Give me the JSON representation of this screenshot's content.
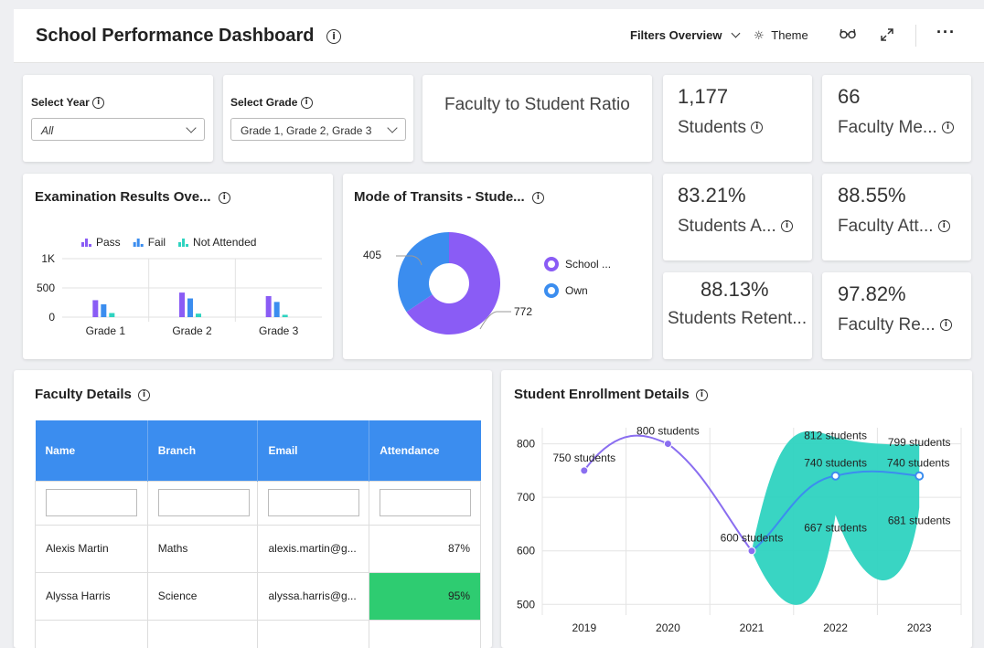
{
  "header": {
    "title": "School Performance Dashboard",
    "filters_label": "Filters Overview",
    "theme_label": "Theme"
  },
  "filters": {
    "year_label": "Select Year",
    "year_value": "All",
    "grade_label": "Select Grade",
    "grade_value": "Grade 1, Grade 2, Grade 3"
  },
  "kpis": {
    "ratio_title": "Faculty to Student Ratio",
    "students_value": "1,177",
    "students_label": "Students",
    "faculty_value": "66",
    "faculty_label": "Faculty Me...",
    "stud_att_value": "83.21%",
    "stud_att_label": "Students A...",
    "fac_att_value": "88.55%",
    "fac_att_label": "Faculty Att...",
    "stud_ret_value": "88.13%",
    "stud_ret_label": "Students Retent...",
    "fac_ret_value": "97.82%",
    "fac_ret_label": "Faculty Re..."
  },
  "exam": {
    "title": "Examination Results Ove..."
  },
  "transit": {
    "title": "Mode of Transits - Stude...",
    "legend": [
      "School ...",
      "Own"
    ],
    "label_a": "405",
    "label_b": "772"
  },
  "faculty": {
    "title": "Faculty Details",
    "columns": [
      "Name",
      "Branch",
      "Email",
      "Attendance"
    ],
    "rows": [
      {
        "name": "Alexis Martin",
        "branch": "Maths",
        "email": "alexis.martin@g...",
        "attendance": "87%"
      },
      {
        "name": "Alyssa Harris",
        "branch": "Science",
        "email": "alyssa.harris@g...",
        "attendance": "95%"
      }
    ]
  },
  "enroll": {
    "title": "Student Enrollment Details"
  },
  "chart_data": [
    {
      "type": "bar",
      "categories": [
        "Grade 1",
        "Grade 2",
        "Grade 3"
      ],
      "series": [
        {
          "name": "Pass",
          "values": [
            290,
            420,
            360
          ],
          "color": "#8a5cf5"
        },
        {
          "name": "Fail",
          "values": [
            220,
            320,
            260
          ],
          "color": "#3b8def"
        },
        {
          "name": "Not Attended",
          "values": [
            70,
            60,
            40
          ],
          "color": "#2ed3c0"
        }
      ],
      "yticks": [
        "0",
        "500",
        "1K"
      ],
      "ylim": [
        0,
        1000
      ],
      "legend": "top"
    },
    {
      "type": "pie",
      "categories": [
        "School ...",
        "Own"
      ],
      "values": [
        772,
        405
      ],
      "colors": [
        "#8a5cf5",
        "#3b8def"
      ]
    },
    {
      "type": "line",
      "categories": [
        "2019",
        "2020",
        "2021",
        "2022",
        "2023"
      ],
      "yticks": [
        "500",
        "600",
        "700",
        "800"
      ],
      "ylim": [
        480,
        830
      ],
      "series": [
        {
          "name": "",
          "values": [
            750,
            800,
            600,
            null,
            null
          ],
          "color": "#8a6ef0",
          "labels": [
            "750 students",
            "800 students",
            "600 students",
            "",
            ""
          ]
        },
        {
          "name": "",
          "values": [
            null,
            null,
            600,
            740,
            740
          ],
          "color": "#3b8def",
          "labels": [
            "",
            "",
            "",
            "740 students",
            "740 students"
          ]
        },
        {
          "name": "",
          "type": "range",
          "high": [
            null,
            null,
            600,
            812,
            799
          ],
          "low": [
            null,
            null,
            600,
            667,
            681
          ],
          "color": "#2ed3c0",
          "labels_high": [
            "",
            "",
            "",
            "812 students",
            "799 students"
          ],
          "labels_low": [
            "",
            "",
            "",
            "667 students",
            "681 students"
          ]
        }
      ]
    }
  ]
}
